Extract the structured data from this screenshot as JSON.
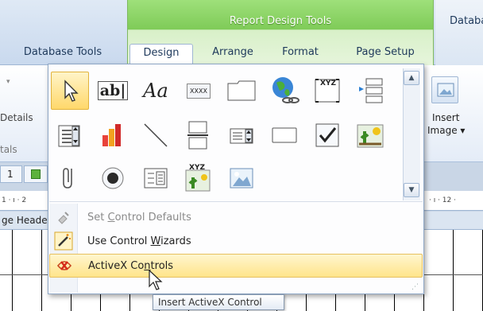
{
  "ribbon": {
    "context_title": "Report Design Tools",
    "right_cut_label": "Databa",
    "tabs": [
      {
        "label": "Database Tools"
      },
      {
        "label": "Design"
      },
      {
        "label": "Arrange"
      },
      {
        "label": "Format"
      },
      {
        "label": "Page Setup"
      }
    ],
    "left_group_label_top": "Details",
    "left_group_label_bottom": "tals",
    "insert_image_label_1": "Insert",
    "insert_image_label_2": "Image ▾"
  },
  "doc": {
    "tab_number": "1",
    "ruler_left": "1 · ı · 2",
    "ruler_right": "· ı · 12 ·",
    "section_label": "ge Heade"
  },
  "gallery": {
    "textbox_label": "ab|",
    "label_control_text": "Aa",
    "button_text": "XXXX",
    "xyz_text": "XYZ"
  },
  "menu": {
    "items": [
      {
        "label_pre": "Set ",
        "mnemonic": "C",
        "label_post": "ontrol Defaults",
        "enabled": false
      },
      {
        "label_pre": "Use Control ",
        "mnemonic": "W",
        "label_post": "izards",
        "enabled": true
      },
      {
        "label_pre": "ActiveX Co",
        "mnemonic": "n",
        "label_post": "trols",
        "enabled": true
      }
    ]
  },
  "tooltip": {
    "text": "Insert ActiveX Control"
  },
  "colors": {
    "context_green": "#7fcb58",
    "highlight": "#ffe48a"
  }
}
